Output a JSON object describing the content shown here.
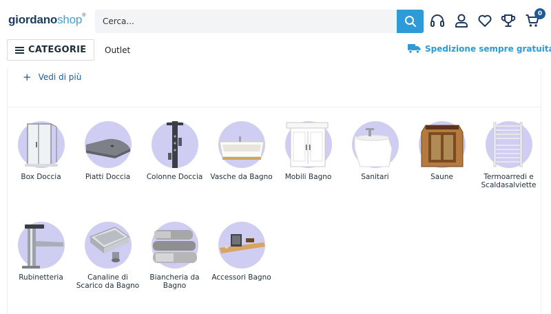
{
  "header": {
    "logo_part1": "giordano",
    "logo_part2": "shop",
    "logo_mark": "®",
    "search_placeholder": "Cerca...",
    "search_icon": "magnifier-icon",
    "icons": [
      "headset-icon",
      "user-icon",
      "heart-icon",
      "trophy-icon",
      "cart-icon"
    ],
    "cart_count": "0",
    "accent_color": "#2e9ad6"
  },
  "nav": {
    "categories_label": "CATEGORIE",
    "outlet_label": "Outlet",
    "shipping_text": "Spedizione sempre gratuita!",
    "shipping_icon": "truck-icon"
  },
  "panel": {
    "see_more_symbol": "+",
    "see_more_label": "Vedi di più"
  },
  "categories": [
    {
      "label": "Box Doccia",
      "icon": "shower-box-icon"
    },
    {
      "label": "Piatti Doccia",
      "icon": "shower-tray-icon"
    },
    {
      "label": "Colonne Doccia",
      "icon": "shower-column-icon"
    },
    {
      "label": "Vasche da Bagno",
      "icon": "bathtub-icon"
    },
    {
      "label": "Mobili Bagno",
      "icon": "bathroom-cabinet-icon"
    },
    {
      "label": "Sanitari",
      "icon": "bidet-icon"
    },
    {
      "label": "Saune",
      "icon": "sauna-icon"
    },
    {
      "label": "Termoarredi e Scaldasalviette",
      "icon": "towel-radiator-icon"
    },
    {
      "label": "Rubinetteria",
      "icon": "faucet-icon"
    },
    {
      "label": "Canaline di Scarico da Bagno",
      "icon": "floor-drain-icon"
    },
    {
      "label": "Biancheria da Bagno",
      "icon": "towels-icon"
    },
    {
      "label": "Accessori Bagno",
      "icon": "bath-caddy-icon"
    }
  ]
}
